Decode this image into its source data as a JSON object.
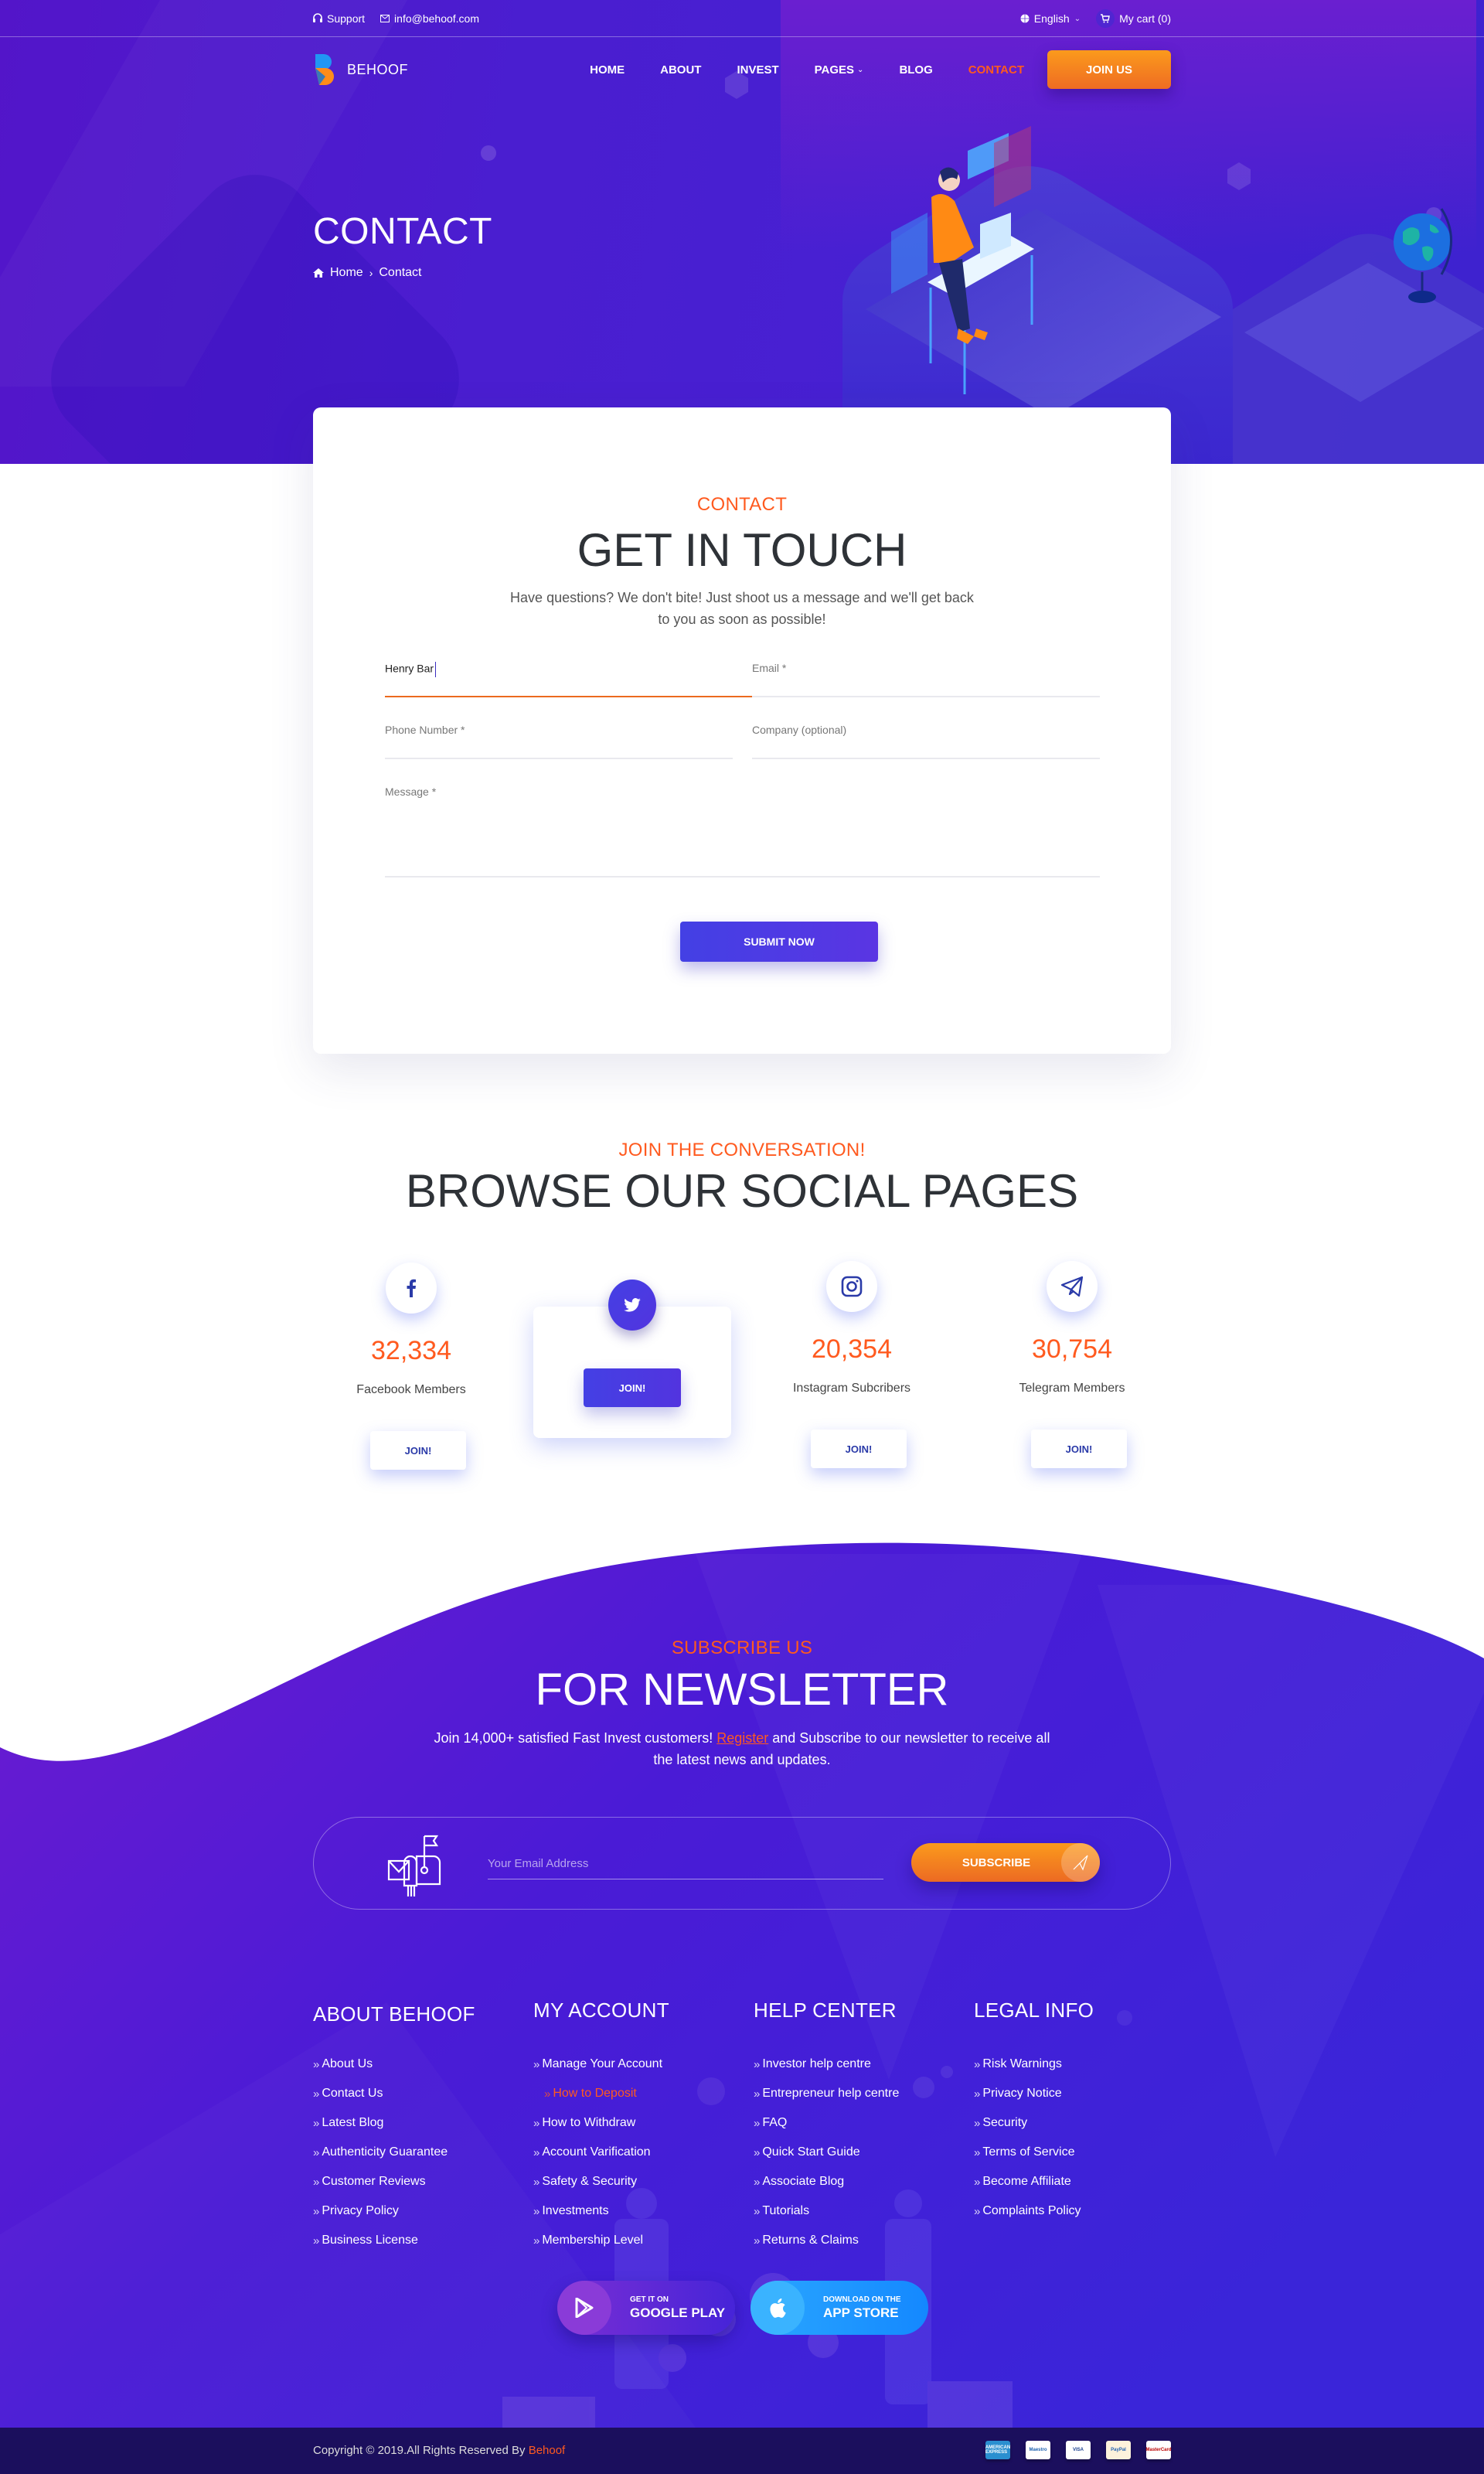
{
  "topbar": {
    "support": "Support",
    "email": "info@behoof.com",
    "language": "English",
    "cart": "My cart (0)"
  },
  "brand": {
    "name": "BEHOOF"
  },
  "nav": {
    "items": [
      {
        "label": "HOME"
      },
      {
        "label": "ABOUT"
      },
      {
        "label": "INVEST"
      },
      {
        "label": "PAGES"
      },
      {
        "label": "BLOG"
      },
      {
        "label": "CONTACT"
      }
    ],
    "active": "CONTACT",
    "join_label": "JOIN US"
  },
  "hero": {
    "title": "CONTACT",
    "breadcrumb": [
      "Home",
      "Contact"
    ]
  },
  "contact": {
    "eyebrow": "CONTACT",
    "title": "GET IN TOUCH",
    "lead": "Have questions? We don't bite! Just shoot us a message and we'll get back to you as soon as possible!",
    "fields": {
      "name_value": "Henry Bar",
      "email_label": "Email *",
      "phone_label": "Phone Number *",
      "company_label": "Company (optional)",
      "message_label": "Message *"
    },
    "submit_label": "SUBMIT NOW"
  },
  "social": {
    "eyebrow": "JOIN THE CONVERSATION!",
    "title": "BROWSE OUR SOCIAL PAGES",
    "items": [
      {
        "network": "facebook",
        "count": "32,334",
        "label": "Facebook Members",
        "button": "JOIN!"
      },
      {
        "network": "twitter",
        "count": "",
        "label": "",
        "button": "JOIN!"
      },
      {
        "network": "instagram",
        "count": "20,354",
        "label": "Instagram Subcribers",
        "button": "JOIN!"
      },
      {
        "network": "telegram",
        "count": "30,754",
        "label": "Telegram Members",
        "button": "JOIN!"
      }
    ]
  },
  "newsletter": {
    "eyebrow": "SUBSCRIBE US",
    "title": "FOR NEWSLETTER",
    "lead_before": "Join 14,000+ satisfied Fast Invest customers! ",
    "lead_link": "Register",
    "lead_after": " and Subscribe to our newsletter to receive all the latest news and updates.",
    "email_placeholder": "Your Email Address",
    "subscribe_label": "SUBSCRIBE"
  },
  "footer": {
    "columns": [
      {
        "title": "ABOUT BEHOOF",
        "links": [
          "About Us",
          "Contact Us",
          "Latest Blog",
          "Authenticity Guarantee",
          "Customer Reviews",
          "Privacy Policy",
          "Business License"
        ]
      },
      {
        "title": "MY ACCOUNT",
        "links": [
          "Manage Your Account",
          "How to Deposit",
          "How to Withdraw",
          "Account Varification",
          "Safety & Security",
          "Investments",
          "Membership Level"
        ]
      },
      {
        "title": "HELP CENTER",
        "links": [
          "Investor help centre",
          "Entrepreneur help centre",
          "FAQ",
          "Quick Start Guide",
          "Associate Blog",
          "Tutorials",
          "Returns & Claims"
        ]
      },
      {
        "title": "LEGAL INFO",
        "links": [
          "Risk Warnings",
          "Privacy Notice",
          "Security",
          "Terms of Service",
          "Become Affiliate",
          "Complaints Policy"
        ]
      }
    ],
    "highlighted_link": "How to Deposit",
    "stores": {
      "google": {
        "line1": "GET IT ON",
        "line2": "GOOGLE PLAY"
      },
      "apple": {
        "line1": "DOWNLOAD ON THE",
        "line2": "APP STORE"
      }
    },
    "copyright_prefix": "Copyright © 2019.All Rights Reserved By ",
    "copyright_brand": "Behoof",
    "payments": [
      {
        "name": "American Express",
        "short": "AMERICAN EXPRESS",
        "bg": "#2a8fd0",
        "fg": "#ffffff"
      },
      {
        "name": "Maestro",
        "short": "Maestro",
        "bg": "#ffffff",
        "fg": "#1a5fae"
      },
      {
        "name": "Visa",
        "short": "VISA",
        "bg": "#ffffff",
        "fg": "#1a3f8f"
      },
      {
        "name": "PayPal",
        "short": "PayPal",
        "bg": "#fdf2dc",
        "fg": "#1e5fb0"
      },
      {
        "name": "MasterCard",
        "short": "MasterCard",
        "bg": "#ffffff",
        "fg": "#b00"
      }
    ]
  },
  "colors": {
    "accent": "#ff5a1f",
    "primary": "#4440e4",
    "hero_bg": "#4a1ed0",
    "footer_bar": "#1b0f5d"
  }
}
